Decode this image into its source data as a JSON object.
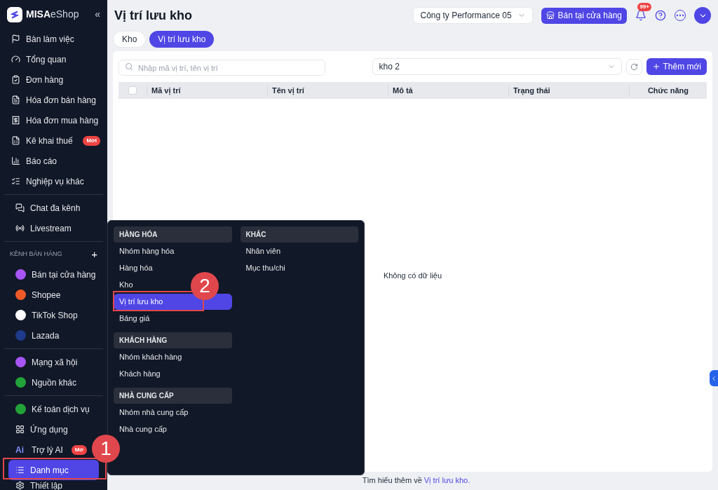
{
  "sidebar": {
    "logo": {
      "brand": "MISA",
      "product": "eShop"
    },
    "collapse": "«",
    "groups": [
      {
        "items": [
          {
            "label": "Bàn làm việc",
            "selected": false
          },
          {
            "label": "Tổng quan",
            "selected": false
          },
          {
            "label": "Đơn hàng",
            "selected": false
          },
          {
            "label": "Hóa đơn bán hàng",
            "selected": false
          },
          {
            "label": "Hóa đơn mua hàng",
            "selected": false
          },
          {
            "label": "Kê khai thuế",
            "selected": false,
            "badge": "Mới"
          },
          {
            "label": "Báo cáo",
            "selected": false
          },
          {
            "label": "Nghiệp vụ khác",
            "selected": false
          }
        ]
      },
      {
        "items": [
          {
            "label": "Chat đa kênh",
            "selected": false
          },
          {
            "label": "Livestream",
            "selected": false
          }
        ]
      },
      {
        "title": "KÊNH BÁN HÀNG",
        "add": "+",
        "items": [
          {
            "label": "Bán tại cửa hàng",
            "selected": false,
            "color": "#a855f7"
          },
          {
            "label": "Shopee",
            "selected": false,
            "color": "#f05a28"
          },
          {
            "label": "TikTok Shop",
            "selected": false,
            "color": "#ffffff"
          },
          {
            "label": "Lazada",
            "selected": false,
            "color": "#1e3a8a"
          }
        ]
      },
      {
        "items": [
          {
            "label": "Mạng xã hội",
            "selected": false,
            "color": "#a855f7"
          },
          {
            "label": "Nguồn khác",
            "selected": false,
            "color": "#22a33a"
          }
        ]
      },
      {
        "items": [
          {
            "label": "Kế toán dịch vụ",
            "selected": false,
            "color": "#22a33a"
          },
          {
            "label": "Ứng dụng",
            "selected": false
          },
          {
            "label": "Trợ lý AI",
            "selected": false,
            "badge": "Mớ",
            "prefix": "Ai"
          },
          {
            "label": "Danh mục",
            "selected": true
          },
          {
            "label": "Thiết lập",
            "selected": false
          }
        ]
      }
    ]
  },
  "header": {
    "title": "Vị trí lưu kho",
    "company": "Công ty Performance 05",
    "store_button": "Bán tại cửa hàng",
    "notifications": "99+"
  },
  "tabs": [
    {
      "label": "Kho",
      "selected": false
    },
    {
      "label": "Vị trí lưu kho",
      "selected": true
    }
  ],
  "search": {
    "placeholder": "Nhập mã vị trí, tên vị trí"
  },
  "warehouse_select": {
    "value": "kho 2"
  },
  "add_button": "Thêm mới",
  "table": {
    "select_all": {
      "checked": false
    },
    "columns": [
      "Mã vị trí",
      "Tên vị trí",
      "Mô tả",
      "Trạng thái",
      "Chức năng"
    ],
    "empty": "Không có dữ liệu"
  },
  "footer": {
    "text": "Tìm hiểu thêm về",
    "link": "Vị trí lưu kho."
  },
  "menu": {
    "columns": [
      [
        {
          "title": "HÀNG HÓA",
          "items": [
            {
              "label": "Nhóm hàng hóa",
              "selected": false
            },
            {
              "label": "Hàng hóa",
              "selected": false
            },
            {
              "label": "Kho",
              "selected": false
            },
            {
              "label": "Vị trí lưu kho",
              "selected": true
            },
            {
              "label": "Bảng giá",
              "selected": false
            }
          ]
        },
        {
          "title": "KHÁCH HÀNG",
          "items": [
            {
              "label": "Nhóm khách hàng",
              "selected": false
            },
            {
              "label": "Khách hàng",
              "selected": false
            }
          ]
        },
        {
          "title": "NHÀ CUNG CẤP",
          "items": [
            {
              "label": "Nhóm nhà cung cấp",
              "selected": false
            },
            {
              "label": "Nhà cung cấp",
              "selected": false
            }
          ]
        }
      ],
      [
        {
          "title": "KHÁC",
          "items": [
            {
              "label": "Nhân viên",
              "selected": false
            },
            {
              "label": "Mục thu/chi",
              "selected": false
            }
          ]
        }
      ]
    ]
  },
  "annotations": [
    {
      "label": "1"
    },
    {
      "label": "2"
    }
  ]
}
